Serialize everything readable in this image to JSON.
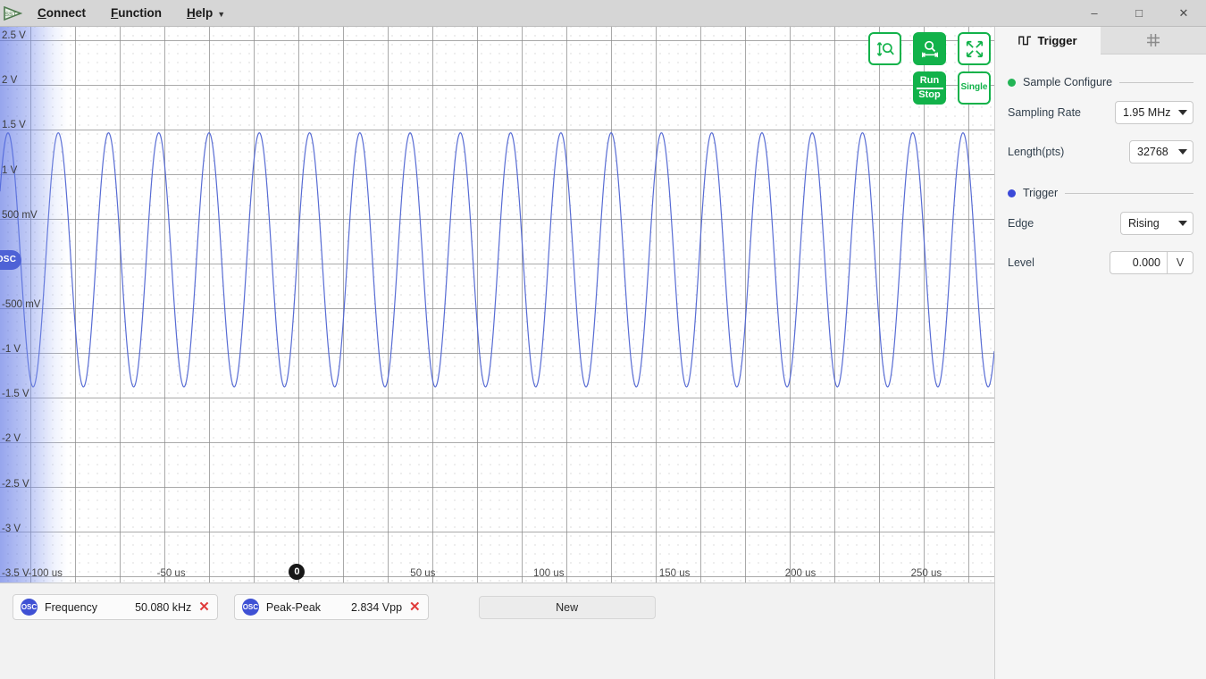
{
  "menubar": {
    "logo_text": "SST",
    "items": [
      {
        "label": "Connect",
        "mnemonic": "C"
      },
      {
        "label": "Function",
        "mnemonic": "F"
      },
      {
        "label": "Help",
        "mnemonic": "H",
        "has_caret": true
      }
    ],
    "window_controls": {
      "minimize": "–",
      "maximize": "□",
      "close": "✕"
    }
  },
  "plot_toolbar": {
    "buttons": [
      {
        "name": "vertical-autoscale",
        "icon": "vertical-zoom-icon",
        "style": "outline"
      },
      {
        "name": "horizontal-autoscale",
        "icon": "horizontal-zoom-icon",
        "style": "filled"
      },
      {
        "name": "fit-to-screen",
        "icon": "expand-arrows-icon",
        "style": "outline"
      },
      {
        "name": "run-stop",
        "label_top": "Run",
        "label_bottom": "Stop",
        "style": "filled"
      },
      {
        "name": "single",
        "label": "Single",
        "style": "outline"
      }
    ]
  },
  "chart_data": {
    "type": "line",
    "title": "",
    "xlabel": "",
    "ylabel": "",
    "waveform": "sine",
    "amplitude_v": 1.417,
    "offset_v": 0.0,
    "frequency_khz": 50.08,
    "period_us": 19.968,
    "xlim": [
      -118,
      277
    ],
    "ylim": [
      -3.6,
      2.6
    ],
    "x_ticks": [
      "-100 us",
      "-50 us",
      "0",
      "50 us",
      "100 us",
      "150 us",
      "200 us",
      "250 us"
    ],
    "x_tick_values": [
      -100,
      -50,
      0,
      50,
      100,
      150,
      200,
      250
    ],
    "y_ticks": [
      "2.5 V",
      "2 V",
      "1.5 V",
      "1 V",
      "500 mV",
      "-500 mV",
      "-1 V",
      "-1.5 V",
      "-2 V",
      "-2.5 V",
      "-3 V",
      "-3.5 V"
    ],
    "y_tick_values": [
      2.5,
      2,
      1.5,
      1,
      0.5,
      -0.5,
      -1,
      -1.5,
      -2,
      -2.5,
      -3,
      -3.5
    ],
    "grid": true,
    "legend": "none",
    "trace_color": "#4a5fd0",
    "channel_marker": {
      "label": "OSC",
      "level_v": 0.0
    },
    "trigger_marker": {
      "label": "0",
      "position_us": 0
    }
  },
  "measurements": {
    "items": [
      {
        "source": "OSC",
        "name": "Frequency",
        "value": "50.080 kHz",
        "close": "✕"
      },
      {
        "source": "OSC",
        "name": "Peak-Peak",
        "value": "2.834 Vpp",
        "close": "✕"
      }
    ],
    "new_button": "New"
  },
  "right_panel": {
    "tabs": [
      {
        "label": "Trigger",
        "icon": "trigger-waveform-icon",
        "active": true
      },
      {
        "label": "",
        "icon": "grid-hash-icon",
        "active": false
      }
    ],
    "sections": [
      {
        "title": "Sample Configure",
        "dot_color": "#22b455",
        "rows": [
          {
            "label": "Sampling Rate",
            "type": "select",
            "value": "1.95 MHz"
          },
          {
            "label": "Length(pts)",
            "type": "select",
            "value": "32768"
          }
        ]
      },
      {
        "title": "Trigger",
        "dot_color": "#3b49d8",
        "rows": [
          {
            "label": "Edge",
            "type": "select",
            "value": "Rising"
          },
          {
            "label": "Level",
            "type": "number",
            "value": "0.000",
            "unit": "V"
          }
        ]
      }
    ]
  },
  "side_toggle": {
    "name": "panel-collapse-arrow"
  }
}
